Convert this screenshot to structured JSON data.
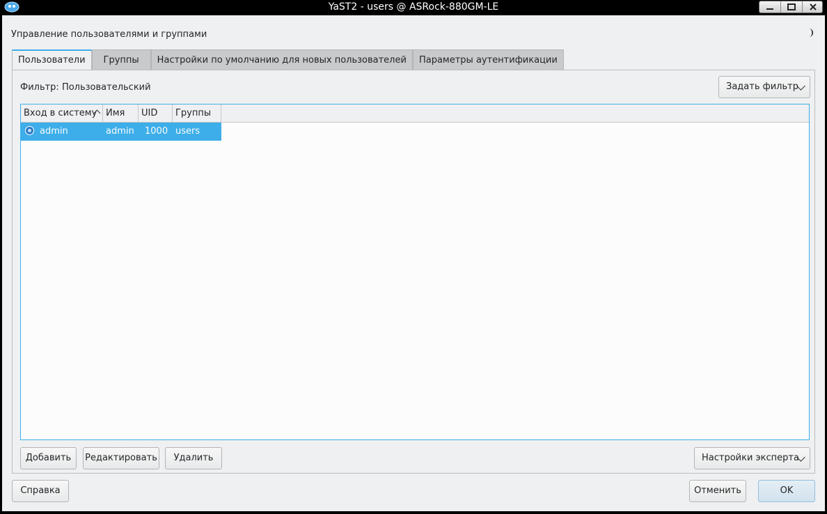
{
  "window": {
    "title": "YaST2 - users @ ASRock-880GM-LE"
  },
  "header": {
    "title": "Управление пользователями и группами"
  },
  "tabs": [
    {
      "label": "Пользователи",
      "active": true
    },
    {
      "label": "Группы",
      "active": false
    },
    {
      "label": "Настройки по умолчанию для новых пользователей",
      "active": false
    },
    {
      "label": "Параметры аутентификации",
      "active": false
    }
  ],
  "filter": {
    "label": "Фильтр: Пользовательский",
    "set_filter_button": "Задать фильтр"
  },
  "table": {
    "columns": [
      "Вход в систему",
      "Имя",
      "UID",
      "Группы"
    ],
    "rows": [
      {
        "login": "admin",
        "name": "admin",
        "uid": "1000",
        "groups": "users",
        "selected": true
      }
    ]
  },
  "actions": {
    "add": "Добавить",
    "edit": "Редактировать",
    "delete": "Удалить",
    "expert": "Настройки эксперта"
  },
  "footer": {
    "help": "Справка",
    "cancel": "Отменить",
    "ok": "OK"
  },
  "colors": {
    "accent": "#3daee9",
    "background": "#eff0f1"
  }
}
